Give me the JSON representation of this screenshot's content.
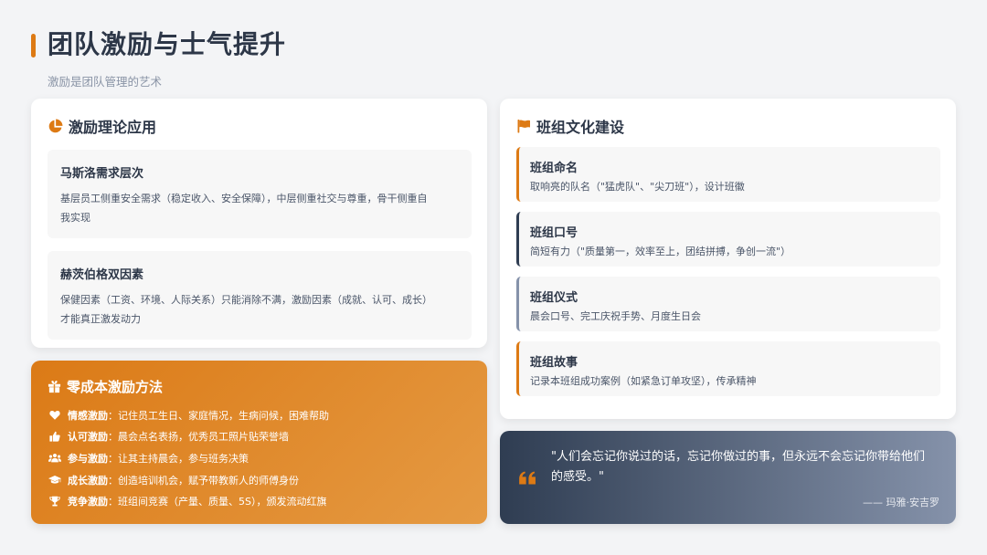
{
  "header": {
    "title": "团队激励与士气提升",
    "subtitle": "激励是团队管理的艺术"
  },
  "theory": {
    "icon": "pie-chart-icon",
    "title": "激励理论应用",
    "items": [
      {
        "title": "马斯洛需求层次",
        "desc_line1": "基层员工侧重安全需求（稳定收入、安全保障），中层侧重社交与尊重，骨干侧重自",
        "desc_line2": "我实现"
      },
      {
        "title": "赫茨伯格双因素",
        "desc_line1": "保健因素（工资、环境、人际关系）只能消除不满，激励因素（成就、认可、成长）",
        "desc_line2": "才能真正激发动力"
      }
    ]
  },
  "zero_cost": {
    "icon": "gift-icon",
    "title": "零成本激励方法",
    "methods": [
      {
        "icon": "heart-icon",
        "label": "情感激励",
        "desc": "：记住员工生日、家庭情况，生病问候，困难帮助"
      },
      {
        "icon": "thumbs-up-icon",
        "label": "认可激励",
        "desc": "：晨会点名表扬，优秀员工照片贴荣誉墙"
      },
      {
        "icon": "users-icon",
        "label": "参与激励",
        "desc": "：让其主持晨会，参与班务决策"
      },
      {
        "icon": "graduation-cap-icon",
        "label": "成长激励",
        "desc": "：创造培训机会，赋予带教新人的师傅身份"
      },
      {
        "icon": "trophy-icon",
        "label": "竞争激励",
        "desc": "：班组间竞赛（产量、质量、5S），颁发流动红旗"
      }
    ]
  },
  "culture": {
    "icon": "flag-icon",
    "title": "班组文化建设",
    "items": [
      {
        "title": "班组命名",
        "desc": "取响亮的队名（\"猛虎队\"、\"尖刀班\"），设计班徽",
        "color": "#dd7a14"
      },
      {
        "title": "班组口号",
        "desc": "简短有力（\"质量第一，效率至上，团结拼搏，争创一流\"）",
        "color": "#2f3d52"
      },
      {
        "title": "班组仪式",
        "desc": "晨会口号、完工庆祝手势、月度生日会",
        "color": "#8592aa"
      },
      {
        "title": "班组故事",
        "desc": "记录本班组成功案例（如紧急订单攻坚），传承精神",
        "color": "#dd7a14"
      }
    ]
  },
  "quote": {
    "icon": "quote-left-icon",
    "line1": "\"人们会忘记你说过的话，忘记你做过的事，但永远不会忘记你带给他们",
    "line2": "的感受。\"",
    "author": "—— 玛雅·安吉罗"
  },
  "colors": {
    "accent": "#dd7a14",
    "dark": "#2f3d52",
    "muted": "#8592aa"
  }
}
